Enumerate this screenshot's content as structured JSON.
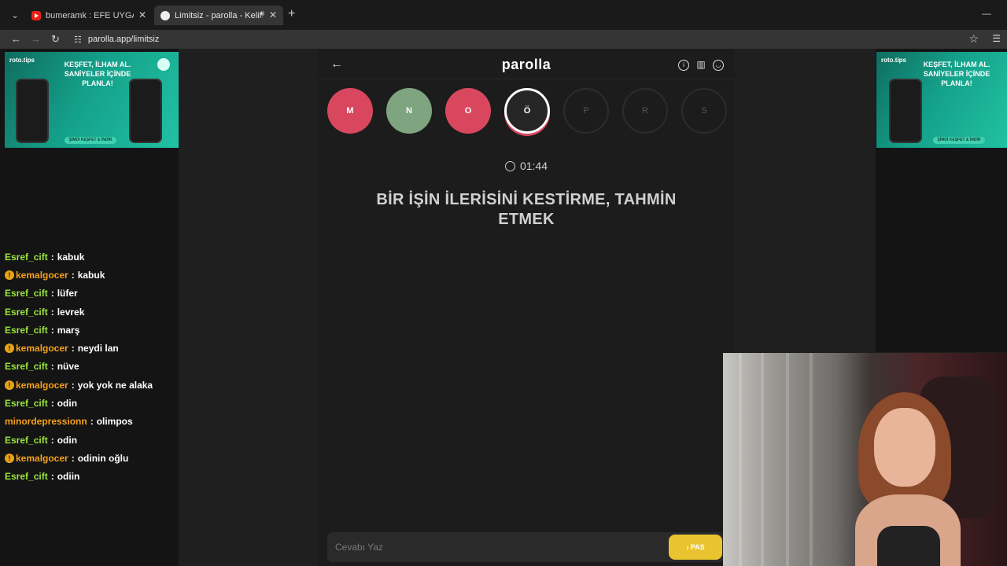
{
  "browser": {
    "tabs": [
      {
        "title": "bumeramk : EFE UYGAC AKIMI",
        "favicon": "youtube-icon",
        "active": false
      },
      {
        "title": "Limitsiz - parolla - Kelime oyunu",
        "favicon": "parolla-icon",
        "active": true
      }
    ],
    "url": "parolla.app/limitsiz"
  },
  "ads": {
    "brand": "roto.tips",
    "headline": "KEŞFET, İLHAM AL. SANİYELER İÇİNDE PLANLA!",
    "cta": "ŞİMDİ KEŞFET & İNDİR"
  },
  "game": {
    "logo": "parolla",
    "letters": [
      {
        "letter": "M",
        "state": "wrong"
      },
      {
        "letter": "N",
        "state": "correct"
      },
      {
        "letter": "O",
        "state": "wrong"
      },
      {
        "letter": "Ö",
        "state": "active"
      },
      {
        "letter": "P",
        "state": "pending"
      },
      {
        "letter": "R",
        "state": "pending"
      },
      {
        "letter": "S",
        "state": "pending"
      }
    ],
    "timer": "01:44",
    "question": "BİR İŞİN İLERİSİNİ KESTİRME, TAHMİN ETMEK",
    "answer_placeholder": "Cevabı Yaz",
    "pass_label": "PAS"
  },
  "chat": [
    {
      "user": "Esref_cift",
      "color": "green",
      "badge": false,
      "message": "kabuk"
    },
    {
      "user": "kemalgocer",
      "color": "orange",
      "badge": true,
      "message": "kabuk"
    },
    {
      "user": "Esref_cift",
      "color": "green",
      "badge": false,
      "message": "lüfer"
    },
    {
      "user": "Esref_cift",
      "color": "green",
      "badge": false,
      "message": "levrek"
    },
    {
      "user": "Esref_cift",
      "color": "green",
      "badge": false,
      "message": "marş"
    },
    {
      "user": "kemalgocer",
      "color": "orange",
      "badge": true,
      "message": "neydi lan"
    },
    {
      "user": "Esref_cift",
      "color": "green",
      "badge": false,
      "message": "nüve"
    },
    {
      "user": "kemalgocer",
      "color": "orange",
      "badge": true,
      "message": "yok yok ne alaka"
    },
    {
      "user": "Esref_cift",
      "color": "green",
      "badge": false,
      "message": "odin"
    },
    {
      "user": "minordepressionn",
      "color": "orange",
      "badge": false,
      "message": "olimpos"
    },
    {
      "user": "Esref_cift",
      "color": "green",
      "badge": false,
      "message": "odin"
    },
    {
      "user": "kemalgocer",
      "color": "orange",
      "badge": true,
      "message": "odinin oğlu"
    },
    {
      "user": "Esref_cift",
      "color": "green",
      "badge": false,
      "message": "odiin"
    }
  ],
  "colors": {
    "wrong": "#d9475f",
    "correct": "#7ea57f",
    "pass_button": "#e9c430",
    "chat_green": "#9be53c",
    "chat_orange": "#f5a11a"
  }
}
